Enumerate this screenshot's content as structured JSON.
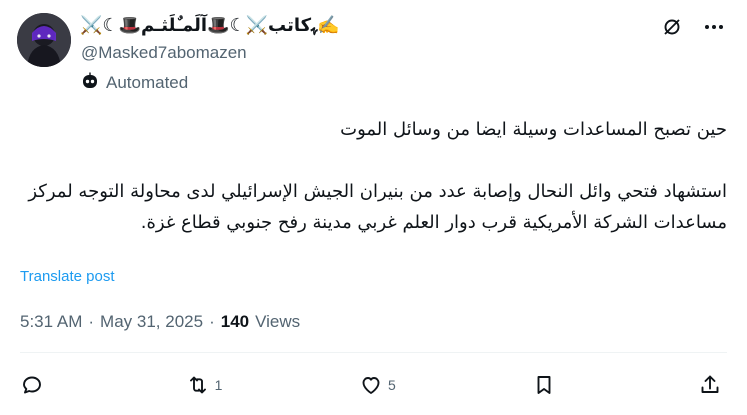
{
  "author": {
    "display_name": "⚔️☾🎩ﮩكاتب⚔️☾🎩آلَمـٌلَثـم✍️",
    "handle": "@Masked7abomazen",
    "automated_label": "Automated"
  },
  "post": {
    "line1": "حين تصبح المساعدات وسيلة ايضا من وسائل الموت",
    "paragraph2": "استشهاد فتحي وائل النحال وإصابة عدد من بنيران الجيش الإسرائيلي لدى محاولة التوجه لمركز مساعدات الشركة الأمريكية قرب دوار العلم غربي مدينة رفح جنوبي قطاع غزة.",
    "translate_label": "Translate post"
  },
  "meta": {
    "time": "5:31 AM",
    "separator1": "·",
    "date": "May 31, 2025",
    "separator2": "·",
    "views_count": "140",
    "views_label": "Views"
  },
  "actions": {
    "reply_count": "",
    "repost_count": "1",
    "like_count": "5",
    "bookmark_count": "",
    "share_count": ""
  },
  "colors": {
    "accent": "#1d9bf0",
    "secondary_text": "#536471",
    "primary_text": "#0f1419",
    "divider": "#eff3f4"
  },
  "icons": [
    "grok-icon",
    "more-icon",
    "robot-icon",
    "reply-icon",
    "repost-icon",
    "like-icon",
    "bookmark-icon",
    "share-icon"
  ]
}
